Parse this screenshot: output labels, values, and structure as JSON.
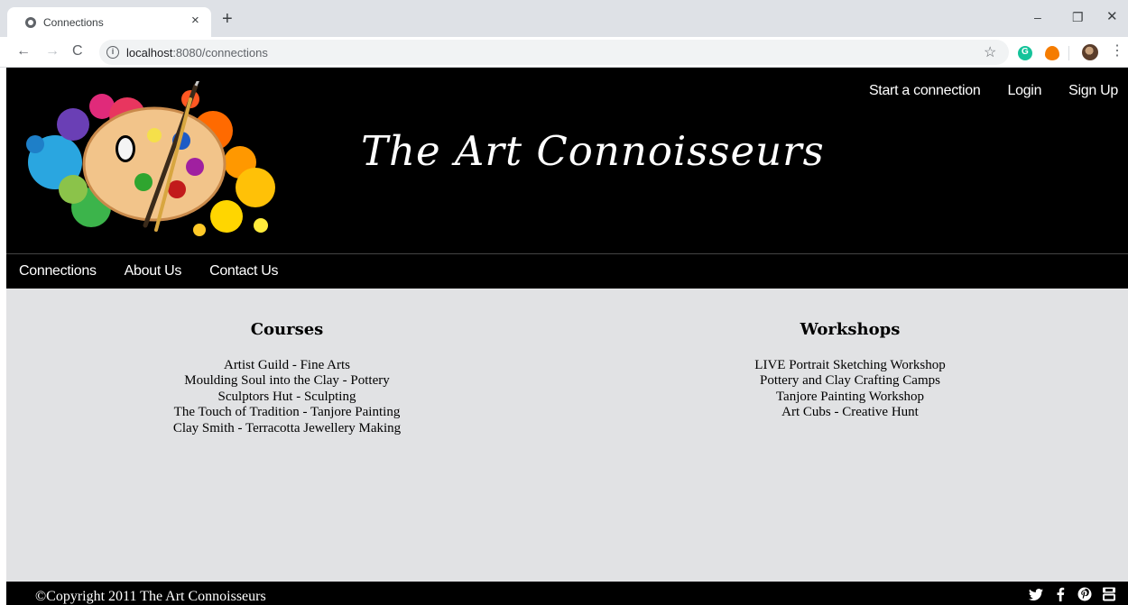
{
  "browser": {
    "tab_title": "Connections",
    "tab_close": "×",
    "new_tab": "+",
    "window_min": "–",
    "window_max": "❐",
    "window_close": "✕",
    "url_host": "localhost",
    "url_path": ":8080/connections",
    "back": "←",
    "forward": "→",
    "reload": "C",
    "info": "i",
    "star": "☆",
    "menu": "⋮"
  },
  "header": {
    "site_title": "The Art Connoisseurs",
    "top_links": [
      "Start a connection",
      "Login",
      "Sign Up"
    ]
  },
  "nav": {
    "links": [
      "Connections",
      "About Us",
      "Contact Us"
    ]
  },
  "courses": {
    "heading": "Courses",
    "items": [
      "Artist Guild - Fine Arts",
      "Moulding Soul into the Clay - Pottery",
      "Sculptors Hut - Sculpting",
      "The Touch of Tradition - Tanjore Painting",
      "Clay Smith - Terracotta Jewellery Making"
    ]
  },
  "workshops": {
    "heading": "Workshops",
    "items": [
      "LIVE Portrait Sketching Workshop",
      "Pottery and Clay Crafting Camps",
      "Tanjore Painting Workshop",
      "Art Cubs - Creative Hunt"
    ]
  },
  "footer": {
    "copyright": "©Copyright 2011 The Art Connoisseurs",
    "social_icons": [
      "twitter-icon",
      "facebook-icon",
      "pinterest-icon",
      "youtube-icon"
    ]
  },
  "colors": {
    "header_bg": "#000000",
    "page_bg": "#e1e2e4",
    "text_light": "#ffffff"
  }
}
